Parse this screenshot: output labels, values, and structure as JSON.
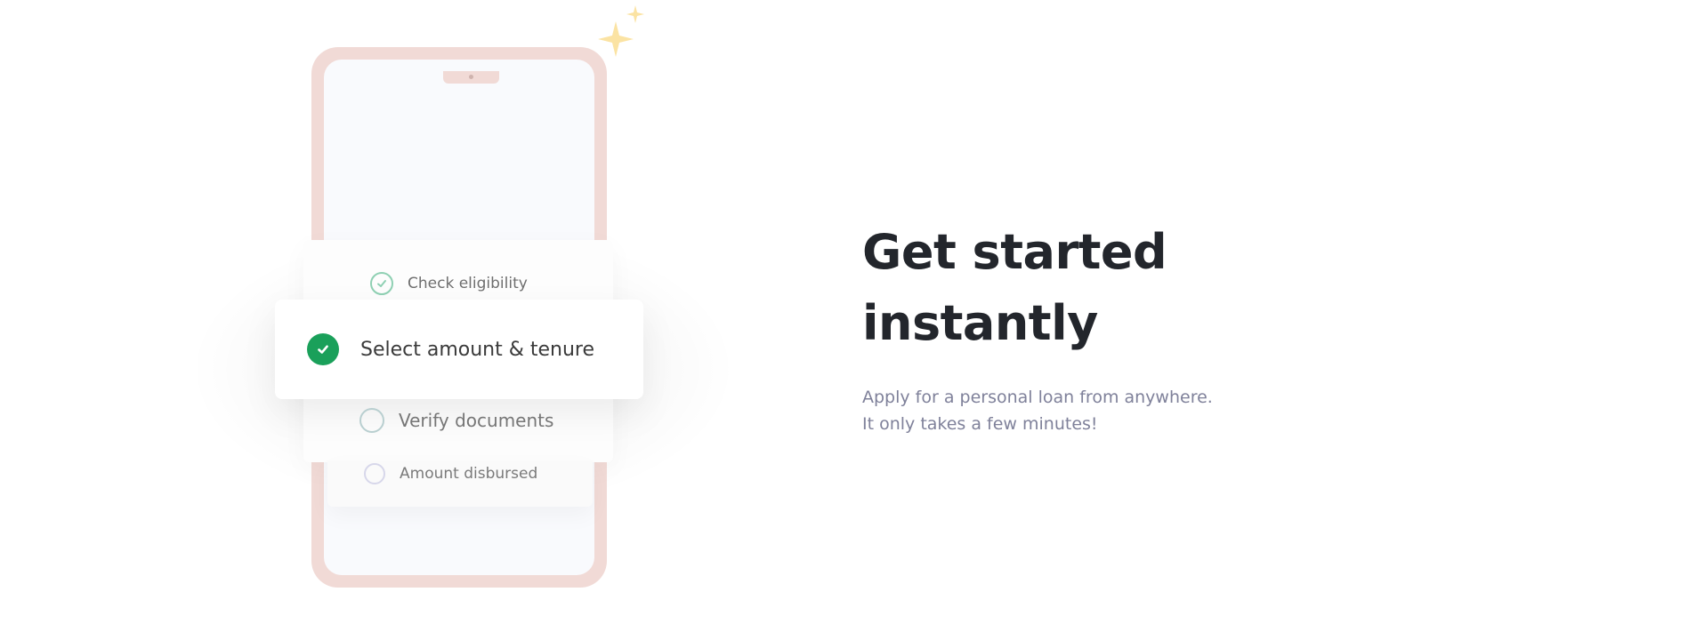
{
  "illustration": {
    "steps": [
      {
        "label": "Check eligibility",
        "state": "done"
      },
      {
        "label": "Select amount & tenure",
        "state": "active"
      },
      {
        "label": "Verify documents",
        "state": "pending"
      },
      {
        "label": "Amount disbursed",
        "state": "pending"
      }
    ],
    "icons": {
      "done": "check-circle-outline-icon",
      "active": "check-circle-filled-icon",
      "pending": "empty-circle-icon",
      "decoration": "sparkle-icon"
    }
  },
  "hero": {
    "headline_line1": "Get started",
    "headline_line2": "instantly",
    "subtext_line1": "Apply for a personal loan from anywhere.",
    "subtext_line2": "It only takes a few minutes!"
  },
  "colors": {
    "phone_frame": "#f1dad6",
    "screen": "#f9fafd",
    "success_green": "#1aa05a",
    "done_outline": "#8fd0b3",
    "headline": "#23262c",
    "subtext": "#7f819a",
    "sparkle": "#fbe3a3"
  }
}
